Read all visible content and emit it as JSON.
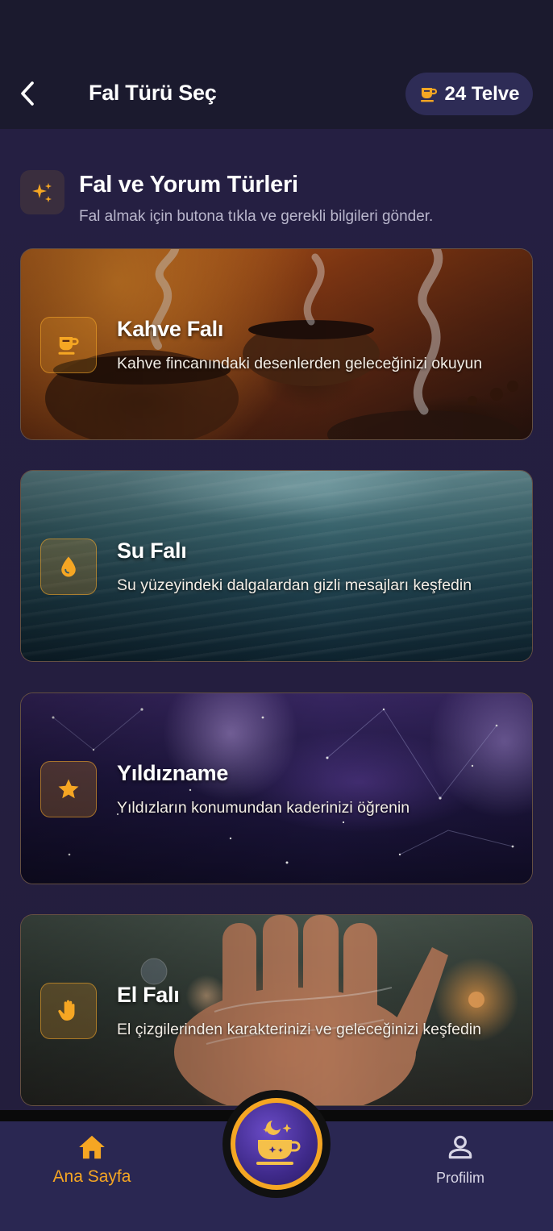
{
  "header": {
    "title": "Fal Türü Seç",
    "credits": "24 Telve"
  },
  "section": {
    "title": "Fal ve Yorum Türleri",
    "subtitle": "Fal almak için butona tıkla ve gerekli bilgileri gönder."
  },
  "cards": [
    {
      "title": "Kahve Falı",
      "description": "Kahve fincanındaki desenlerden geleceğinizi okuyun",
      "icon": "coffee-cup-icon"
    },
    {
      "title": "Su Falı",
      "description": "Su yüzeyindeki dalgalardan gizli mesajları keşfedin",
      "icon": "water-drop-icon"
    },
    {
      "title": "Yıldızname",
      "description": "Yıldızların konumundan kaderinizi öğrenin",
      "icon": "star-icon"
    },
    {
      "title": "El Falı",
      "description": "El çizgilerinden karakterinizi ve geleceğinizi keşfedin",
      "icon": "hand-icon"
    }
  ],
  "bottom_nav": {
    "home_label": "Ana Sayfa",
    "profile_label": "Profilim"
  },
  "colors": {
    "accent": "#f5a623",
    "header_bg": "#1b1a2e",
    "page_bg": "#231e3d",
    "nav_bg": "#2a2752"
  }
}
